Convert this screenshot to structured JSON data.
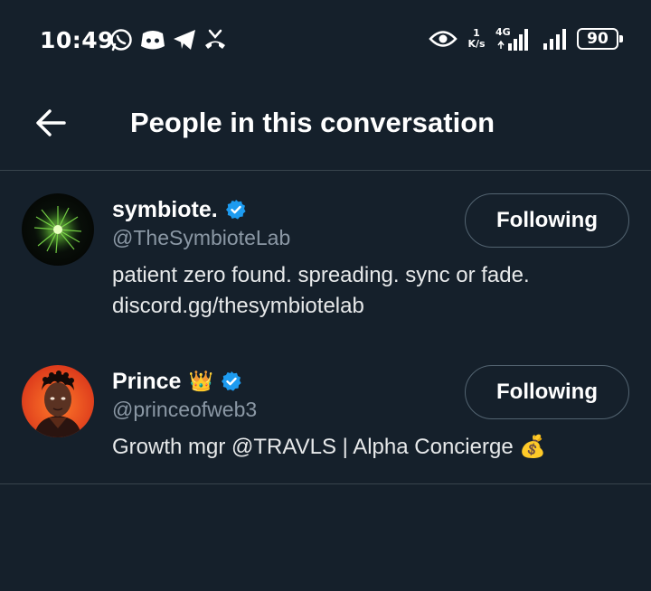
{
  "status_bar": {
    "time": "10:49",
    "net_speed_value": "1",
    "net_speed_unit": "K/s",
    "network_type": "4G",
    "battery": "90",
    "left_icons": [
      "whatsapp-icon",
      "discord-icon",
      "telegram-icon",
      "missed-call-icon"
    ],
    "right_icons": [
      "eye-icon",
      "signal-icon",
      "battery-icon"
    ]
  },
  "header": {
    "title": "People in this conversation",
    "back_icon": "arrow-left-icon"
  },
  "people": [
    {
      "name": "symbiote.",
      "verified": true,
      "handle": "@TheSymbioteLab",
      "bio_line1": "patient zero found. spreading. sync or fade.",
      "bio_line2": "discord.gg/thesymbiotelab",
      "follow_label": "Following"
    },
    {
      "name": "Prince",
      "name_emoji": "👑",
      "verified": true,
      "handle": "@princeofweb3",
      "bio_line1": "Growth mgr @TRAVLS | Alpha Concierge 💰",
      "follow_label": "Following"
    }
  ],
  "colors": {
    "background": "#15202b",
    "divider": "#38444d",
    "verified_badge": "#1d9bf0",
    "handle_text": "#8b98a5",
    "button_border": "#536471"
  }
}
